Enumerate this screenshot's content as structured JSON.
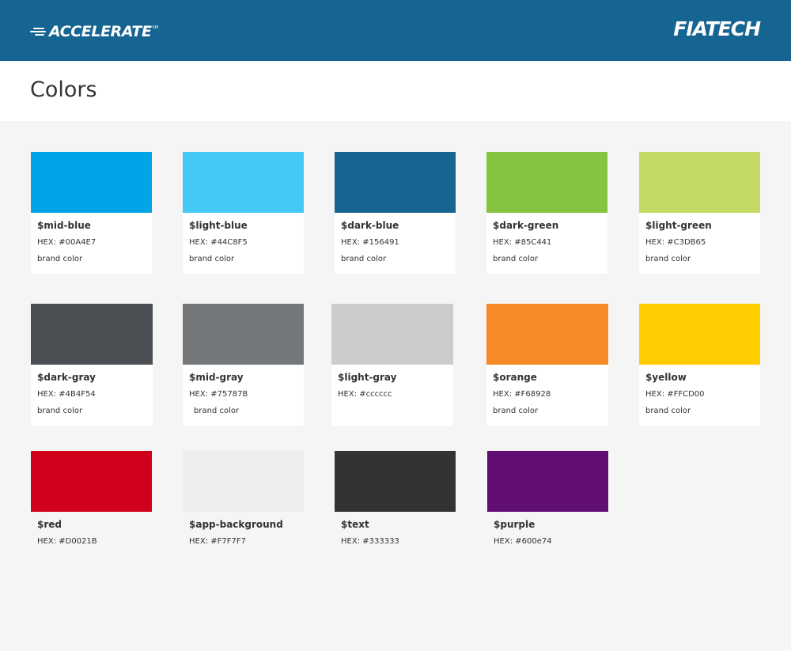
{
  "header": {
    "left_logo": "ACCELERATE",
    "left_logo_mark": "SM",
    "right_logo": "FIATECH",
    "background": "#156491"
  },
  "page": {
    "title": "Colors",
    "background": "#F5F5F5"
  },
  "colors": [
    {
      "name": "$mid-blue",
      "hex_label": "HEX: #00A4E7",
      "note": "brand color",
      "swatch": "#00A4E7"
    },
    {
      "name": "$light-blue",
      "hex_label": "HEX: #44C8F5",
      "note": "brand color",
      "swatch": "#44C8F5"
    },
    {
      "name": "$dark-blue",
      "hex_label": "HEX: #156491",
      "note": "brand color",
      "swatch": "#156491"
    },
    {
      "name": "$dark-green",
      "hex_label": "HEX: #85C441",
      "note": "brand color",
      "swatch": "#85C441"
    },
    {
      "name": "$light-green",
      "hex_label": "HEX: #C3DB65",
      "note": "brand color",
      "swatch": "#C3DB65"
    },
    {
      "name": "$dark-gray",
      "hex_label": "HEX: #4B4F54",
      "note": "brand color",
      "swatch": "#4B4F54"
    },
    {
      "name": "$mid-gray",
      "hex_label": "HEX: #75787B",
      "note": "brand color",
      "swatch": "#75787B"
    },
    {
      "name": "$light-gray",
      "hex_label": "HEX: #cccccc",
      "note": "",
      "swatch": "#cccccc"
    },
    {
      "name": "$orange",
      "hex_label": "HEX: #F68928",
      "note": "brand color",
      "swatch": "#F68928"
    },
    {
      "name": "$yellow",
      "hex_label": "HEX: #FFCD00",
      "note": "brand color",
      "swatch": "#FFCD00"
    },
    {
      "name": "$red",
      "hex_label": "HEX: #D0021B",
      "note": "",
      "swatch": "#D0021B"
    },
    {
      "name": "$app-background",
      "hex_label": "HEX: #F7F7F7",
      "note": "",
      "swatch": "#EEEEEE"
    },
    {
      "name": "$text",
      "hex_label": "HEX: #333333",
      "note": "",
      "swatch": "#333333"
    },
    {
      "name": "$purple",
      "hex_label": "HEX: #600e74",
      "note": "",
      "swatch": "#600E74"
    }
  ]
}
